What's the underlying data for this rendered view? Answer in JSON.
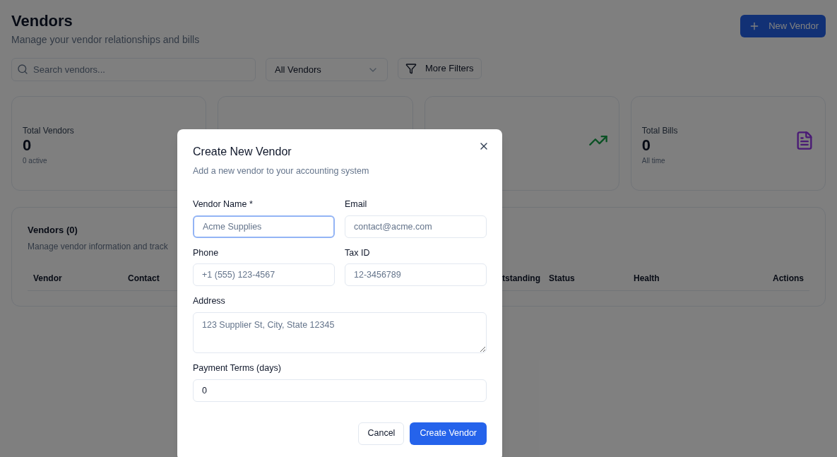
{
  "header": {
    "title": "Vendors",
    "subtitle": "Manage your vendor relationships and bills",
    "new_button": "New Vendor"
  },
  "filters": {
    "search": {
      "placeholder": "Search vendors..."
    },
    "select": {
      "value": "All Vendors"
    },
    "more_button": "More Filters"
  },
  "stats": [
    {
      "kind": "text",
      "label": "Total Vendors",
      "value": "0",
      "note": "0 active"
    },
    {
      "kind": "hidden"
    },
    {
      "kind": "trend"
    },
    {
      "kind": "bills",
      "label": "Total Bills",
      "value": "0",
      "note": "All time"
    }
  ],
  "table": {
    "title": "Vendors (0)",
    "subtitle": "Manage vendor information and track",
    "columns": [
      "Vendor",
      "Contact",
      "tstanding",
      "Status",
      "Health",
      "Actions"
    ]
  },
  "dialog": {
    "title": "Create New Vendor",
    "subtitle": "Add a new vendor to your accounting system",
    "fields": [
      {
        "label": "Vendor Name *",
        "placeholder": "Acme Supplies",
        "focused": true
      },
      {
        "label": "Email",
        "placeholder": "contact@acme.com",
        "focused": false
      },
      {
        "label": "Phone",
        "placeholder": "+1 (555) 123-4567",
        "focused": false
      },
      {
        "label": "Tax ID",
        "placeholder": "12-3456789",
        "focused": false
      }
    ],
    "address": {
      "label": "Address",
      "placeholder": "123 Supplier St, City, State 12345"
    },
    "terms": {
      "label": "Payment Terms (days)",
      "value": "0"
    },
    "cancel": "Cancel",
    "submit": "Create Vendor"
  }
}
